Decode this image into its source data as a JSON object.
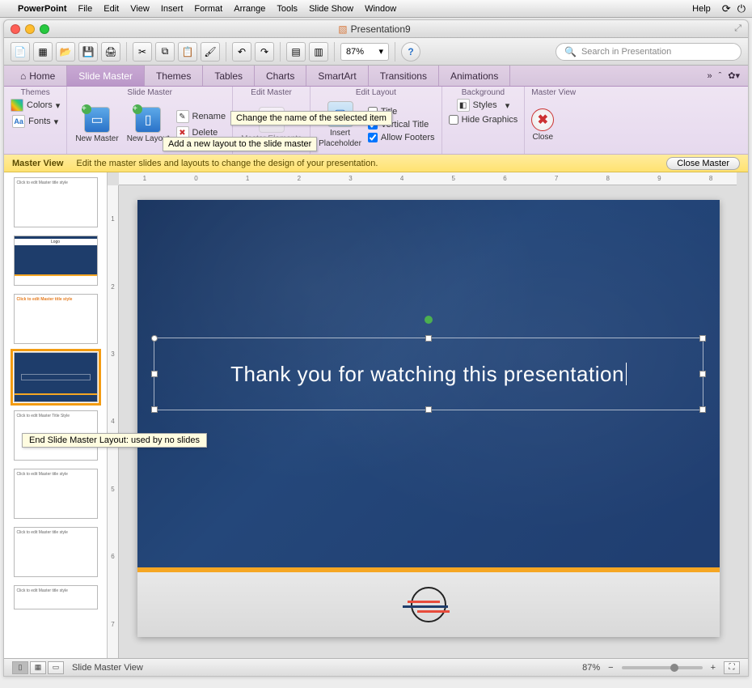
{
  "menubar": {
    "app": "PowerPoint",
    "items": [
      "File",
      "Edit",
      "View",
      "Insert",
      "Format",
      "Arrange",
      "Tools",
      "Slide Show",
      "Window"
    ],
    "help": "Help"
  },
  "window": {
    "title": "Presentation9"
  },
  "toolbar": {
    "zoom": "87%",
    "search_placeholder": "Search in Presentation"
  },
  "ribbon": {
    "tabs": [
      "Home",
      "Slide Master",
      "Themes",
      "Tables",
      "Charts",
      "SmartArt",
      "Transitions",
      "Animations"
    ],
    "groups": {
      "themes": {
        "title": "Themes",
        "colors": "Colors",
        "fonts": "Fonts"
      },
      "slide_master": {
        "title": "Slide Master",
        "new_master": "New Master",
        "new_layout": "New Layout",
        "rename": "Rename",
        "delete": "Delete"
      },
      "edit_master": {
        "title": "Edit Master",
        "master_elements": "Master Elements"
      },
      "edit_layout": {
        "title": "Edit Layout",
        "insert_placeholder": "Insert Placeholder",
        "title_cb": "Title",
        "vertical_title_cb": "Vertical Title",
        "allow_footers_cb": "Allow Footers"
      },
      "background": {
        "title": "Background",
        "styles": "Styles",
        "hide_graphics": "Hide Graphics"
      },
      "master_view": {
        "title": "Master View",
        "close": "Close"
      }
    },
    "tooltip_rename": "Change the name of the selected item",
    "tooltip_new_layout": "Add a new layout to the slide master"
  },
  "infobar": {
    "title": "Master View",
    "message": "Edit the master slides and layouts to change the design of your presentation.",
    "close": "Close Master"
  },
  "slide_tooltip": "End Slide Master Layout: used by no slides",
  "slide_text": "Thank you for watching this presentation",
  "ruler_h": [
    "1",
    "0",
    "1",
    "2",
    "3",
    "4",
    "5",
    "6",
    "7",
    "8",
    "9",
    "8"
  ],
  "ruler_v": [
    "1",
    "2",
    "3",
    "4",
    "5",
    "6",
    "7"
  ],
  "statusbar": {
    "label": "Slide Master View",
    "zoom": "87%"
  },
  "checkboxes": {
    "title": false,
    "vertical_title": true,
    "allow_footers": true,
    "hide_graphics": false
  }
}
